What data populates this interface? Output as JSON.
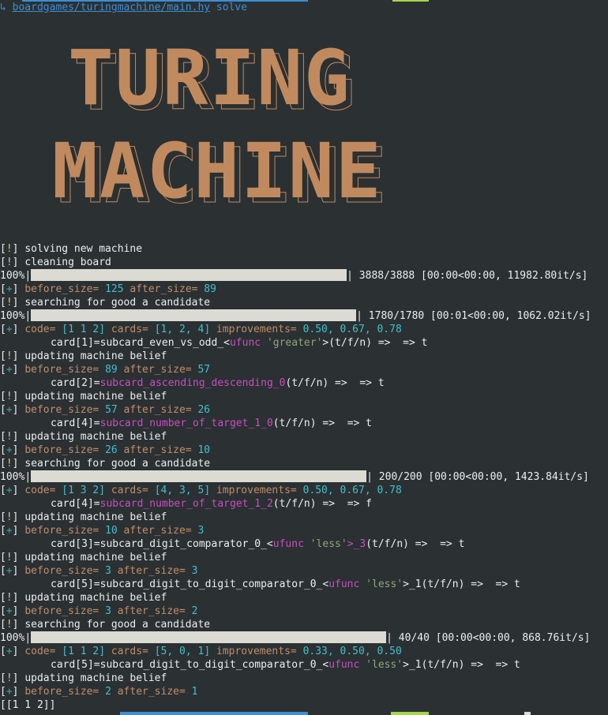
{
  "colors": {
    "background": "#2b3032",
    "banner": "#c08a5e",
    "keyword": "#c08e6b",
    "number": "#3fc1d1",
    "magenta": "#c74ec2",
    "string": "#8ea67a",
    "prompt": "#3b8fd6",
    "progress_bar": "#dbdbd3"
  },
  "prompt": {
    "arrow": "↳",
    "path": "boardgames/turingmachine/main.hy",
    "command": " solve"
  },
  "banner": {
    "line1": "TURING",
    "line2": "MACHINE"
  },
  "log": {
    "solving": "solving new machine",
    "cleaning": "cleaning board",
    "updating": "updating machine belief",
    "searching": "searching for good a candidate",
    "before_size": "before_size=",
    "after_size": "after_size=",
    "code": "code=",
    "cards": "cards=",
    "improvements": "improvements=",
    "tag_info": "[!]",
    "tag_plus": "[+]"
  },
  "progress": [
    {
      "percent": "100%",
      "fill": 1.0,
      "stats": "| 3888/3888 [00:00<00:00, 11982.80it/s]"
    },
    {
      "percent": "100%",
      "fill": 1.0,
      "stats": "| 1780/1780 [00:01<00:00, 1062.02it/s]"
    },
    {
      "percent": "100%",
      "fill": 1.0,
      "stats": "| 200/200 [00:00<00:00, 1423.84it/s]"
    },
    {
      "percent": "100%",
      "fill": 1.0,
      "stats": "| 40/40 [00:00<00:00, 868.76it/s]"
    }
  ],
  "sizes": [
    {
      "before": "125",
      "after": "89"
    },
    {
      "before": "89",
      "after": "57"
    },
    {
      "before": "57",
      "after": "26"
    },
    {
      "before": "26",
      "after": "10"
    },
    {
      "before": "10",
      "after": "3"
    },
    {
      "before": "3",
      "after": "3"
    },
    {
      "before": "3",
      "after": "2"
    },
    {
      "before": "2",
      "after": "1"
    }
  ],
  "candidates": [
    {
      "code": "[1 1 2]",
      "cards": "[1, 2, 4]",
      "improvements": "0.50, 0.67, 0.78"
    },
    {
      "code": "[1 3 2]",
      "cards": "[4, 3, 5]",
      "improvements": "0.50, 0.67, 0.78"
    },
    {
      "code": "[1 1 2]",
      "cards": "[5, 0, 1]",
      "improvements": "0.33, 0.50, 0.50"
    }
  ],
  "cardlines": [
    {
      "prefix": "card[1]=subcard_even_vs_odd_<",
      "mag": "ufunc",
      "str": " 'greater'",
      "mag_suffix": "",
      "suffix": ">(t/f/n) =>  => t"
    },
    {
      "prefix": "card[2]=",
      "mag": "subcard_ascending_descending_0",
      "str": "",
      "mag_suffix": "",
      "suffix": "(t/f/n) =>  => t"
    },
    {
      "prefix": "card[4]=",
      "mag": "subcard_number_of_target_1_0",
      "str": "",
      "mag_suffix": "",
      "suffix": "(t/f/n) =>  => t"
    },
    {
      "prefix": "card[4]=",
      "mag": "subcard_number_of_target_1_2",
      "str": "",
      "mag_suffix": "",
      "suffix": "(t/f/n) =>  => f"
    },
    {
      "prefix": "card[3]=subcard_digit_comparator_0_<",
      "mag": "ufunc",
      "str": " 'less'",
      "mag_suffix": ">_3",
      "suffix": "(t/f/n) =>  => t"
    },
    {
      "prefix": "card[5]=subcard_digit_to_digit_comparator_0_<",
      "mag": "ufunc",
      "str": " 'less'",
      "mag_suffix": ">_1",
      "suffix": "(t/f/n) =>  => t"
    },
    {
      "prefix": "card[5]=subcard_digit_to_digit_comparator_0_<",
      "mag": "ufunc",
      "str": " 'less'",
      "mag_suffix": ">_1",
      "suffix": "(t/f/n) =>  => t"
    }
  ],
  "result": "[[1 1 2]]"
}
